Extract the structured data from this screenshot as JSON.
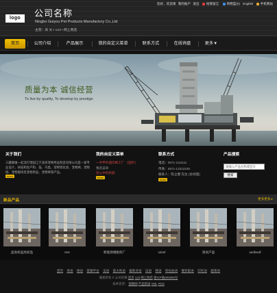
{
  "header": {
    "logo": "logo",
    "company_cn": "公司名称",
    "company_en": "Ningbo Guiyou Pet Products Manufactory Co.,Ltd",
    "products_line": "主营：床 文 • 123 • 网上商店",
    "toplinks": [
      "您好，欢迎来",
      "我的账户",
      "退出",
      "给我留言",
      "购物篮(0)",
      "English",
      "手机网站"
    ],
    "toplink_colors": [
      "#e23b3b",
      "#3b8fe2",
      "#e2a93b",
      "#3be27a"
    ]
  },
  "nav": {
    "items": [
      "首页",
      "公司介绍",
      "产品展示",
      "我的自定义菜单",
      "联系方式",
      "在线询盘",
      "更多▼"
    ],
    "active_index": 0,
    "active_color": "#e6b400"
  },
  "banner": {
    "slogan_cn": "质量为本  诚信经营",
    "slogan_en": "To live by quality, To develop by prestige",
    "slogan_color": "#3d5a1e"
  },
  "about": {
    "title": "关于我们",
    "text": "三藏寓做一起流打理固江宁波宋宠物用品制造有限公司是一家专业设计，研发和生产狗、猫、鸟类，宠物等玩具、宠物窝、宠物链、宠物服饰及宠物用品、宠物窝等产品。",
    "more_label": "more"
  },
  "custom_menu": {
    "title": "我的自定义菜单",
    "links": [
      "一手申外国印刷工厂 《国外》",
      "我的菜单",
      "宽心中的标题"
    ],
    "more_label": "more"
  },
  "contact": {
    "title": "联系方式",
    "lines": [
      "电话：0571-1111111",
      "传真：0571-12312245",
      "联系人：陈立健 先生 (总经理)"
    ],
    "more_label": "more"
  },
  "search": {
    "title": "产品搜索",
    "placeholder": "请输入产品名称或型号",
    "button_label": "搜索"
  },
  "products": {
    "title": "新品产品",
    "more_label": "更多更多 ▸",
    "items": [
      "品高标品高标品",
      "test",
      "新能源储能机厂",
      "sdssf",
      "测试产品",
      "asdfasdf"
    ]
  },
  "footer": {
    "links": [
      "首页",
      "英语",
      "德语",
      "客服平台",
      "法语",
      "意大利语",
      "葡萄牙语",
      "日语",
      "韩语",
      "阿拉伯语",
      "俄罗斯语",
      "印尼语",
      "越南语"
    ],
    "line1": [
      "版权所有 © 公司名称",
      "首页",
      "123",
      "网上商店",
      "浙ICP备000000号"
    ],
    "line2": [
      "技术支持：",
      "保网网",
      "产品目录",
      "XML",
      "RSS"
    ]
  }
}
